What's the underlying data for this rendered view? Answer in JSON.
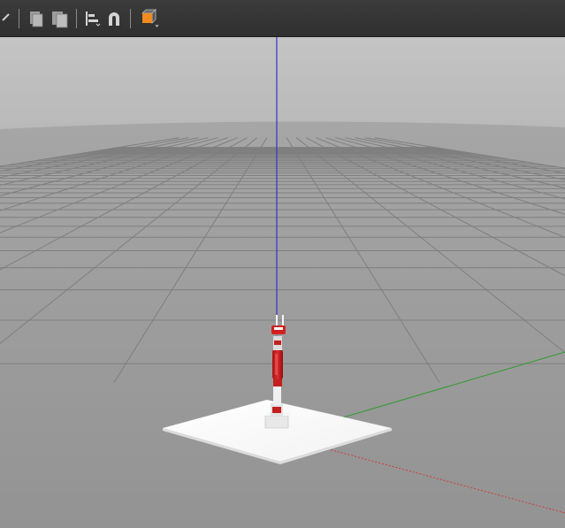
{
  "window": {
    "width": 639,
    "height": 597
  },
  "toolbar": {
    "buttons": [
      {
        "icon": "select-arrow-icon",
        "name": "select-mode-button"
      },
      {
        "icon": "copy-icon",
        "name": "copy-button"
      },
      {
        "icon": "paste-icon",
        "name": "paste-button"
      },
      {
        "icon": "align-icon",
        "name": "align-button"
      },
      {
        "icon": "snap-magnet-icon",
        "name": "snap-button"
      },
      {
        "icon": "view-angle-cube-icon",
        "name": "view-angle-button"
      }
    ],
    "accent_color": "#f28a1e"
  },
  "scene": {
    "sky_color": "#bcbcbc",
    "ground_color": "#9c9c9c",
    "grid_color": "#7f7f7f",
    "axis_colors": {
      "x": "#d03a3a",
      "y": "#2e9a2e",
      "z": "#2f2fd6"
    },
    "model": {
      "base_plate_color": "#ffffff",
      "link_color": "#cc1f1f",
      "joint_color": "#e6e6e6"
    }
  }
}
